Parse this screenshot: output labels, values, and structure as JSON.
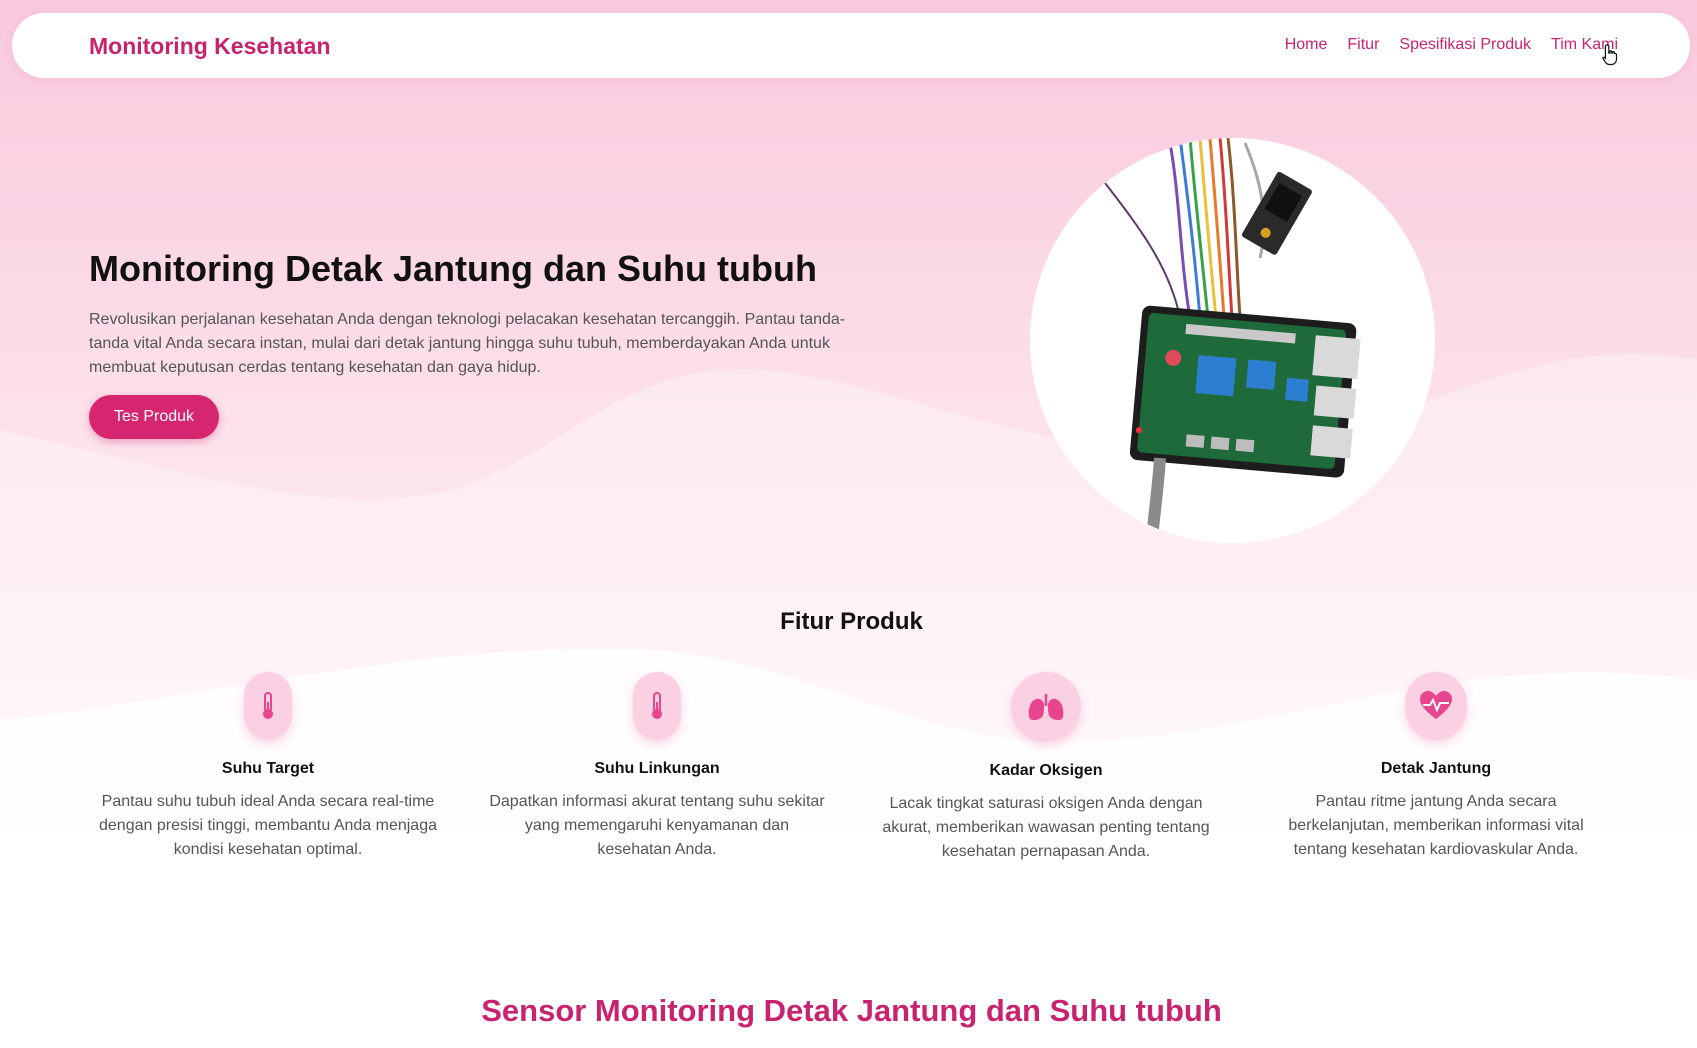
{
  "nav": {
    "brand": "Monitoring Kesehatan",
    "links": [
      "Home",
      "Fitur",
      "Spesifikasi Produk",
      "Tim Kami"
    ]
  },
  "hero": {
    "title": "Monitoring Detak Jantung dan Suhu tubuh",
    "description": "Revolusikan perjalanan kesehatan Anda dengan teknologi pelacakan kesehatan tercanggih. Pantau tanda-tanda vital Anda secara instan, mulai dari detak jantung hingga suhu tubuh, memberdayakan Anda untuk membuat keputusan cerdas tentang kesehatan dan gaya hidup.",
    "button": "Tes Produk"
  },
  "features": {
    "title": "Fitur Produk",
    "items": [
      {
        "icon": "thermometer-icon",
        "title": "Suhu Target",
        "desc": "Pantau suhu tubuh ideal Anda secara real-time dengan presisi tinggi, membantu Anda menjaga kondisi kesehatan optimal."
      },
      {
        "icon": "thermometer-icon",
        "title": "Suhu Linkungan",
        "desc": "Dapatkan informasi akurat tentang suhu sekitar yang memengaruhi kenyamanan dan kesehatan Anda."
      },
      {
        "icon": "lungs-icon",
        "title": "Kadar Oksigen",
        "desc": "Lacak tingkat saturasi oksigen Anda dengan akurat, memberikan wawasan penting tentang kesehatan pernapasan Anda."
      },
      {
        "icon": "heartbeat-icon",
        "title": "Detak Jantung",
        "desc": "Pantau ritme jantung Anda secara berkelanjutan, memberikan informasi vital tentang kesehatan kardiovaskular Anda."
      }
    ]
  },
  "sensor": {
    "title": "Sensor Monitoring Detak Jantung dan Suhu tubuh"
  },
  "colors": {
    "accent": "#c8236f",
    "button": "#d62670",
    "icon_bg": "#fbd0e2",
    "icon": "#e8458f"
  }
}
